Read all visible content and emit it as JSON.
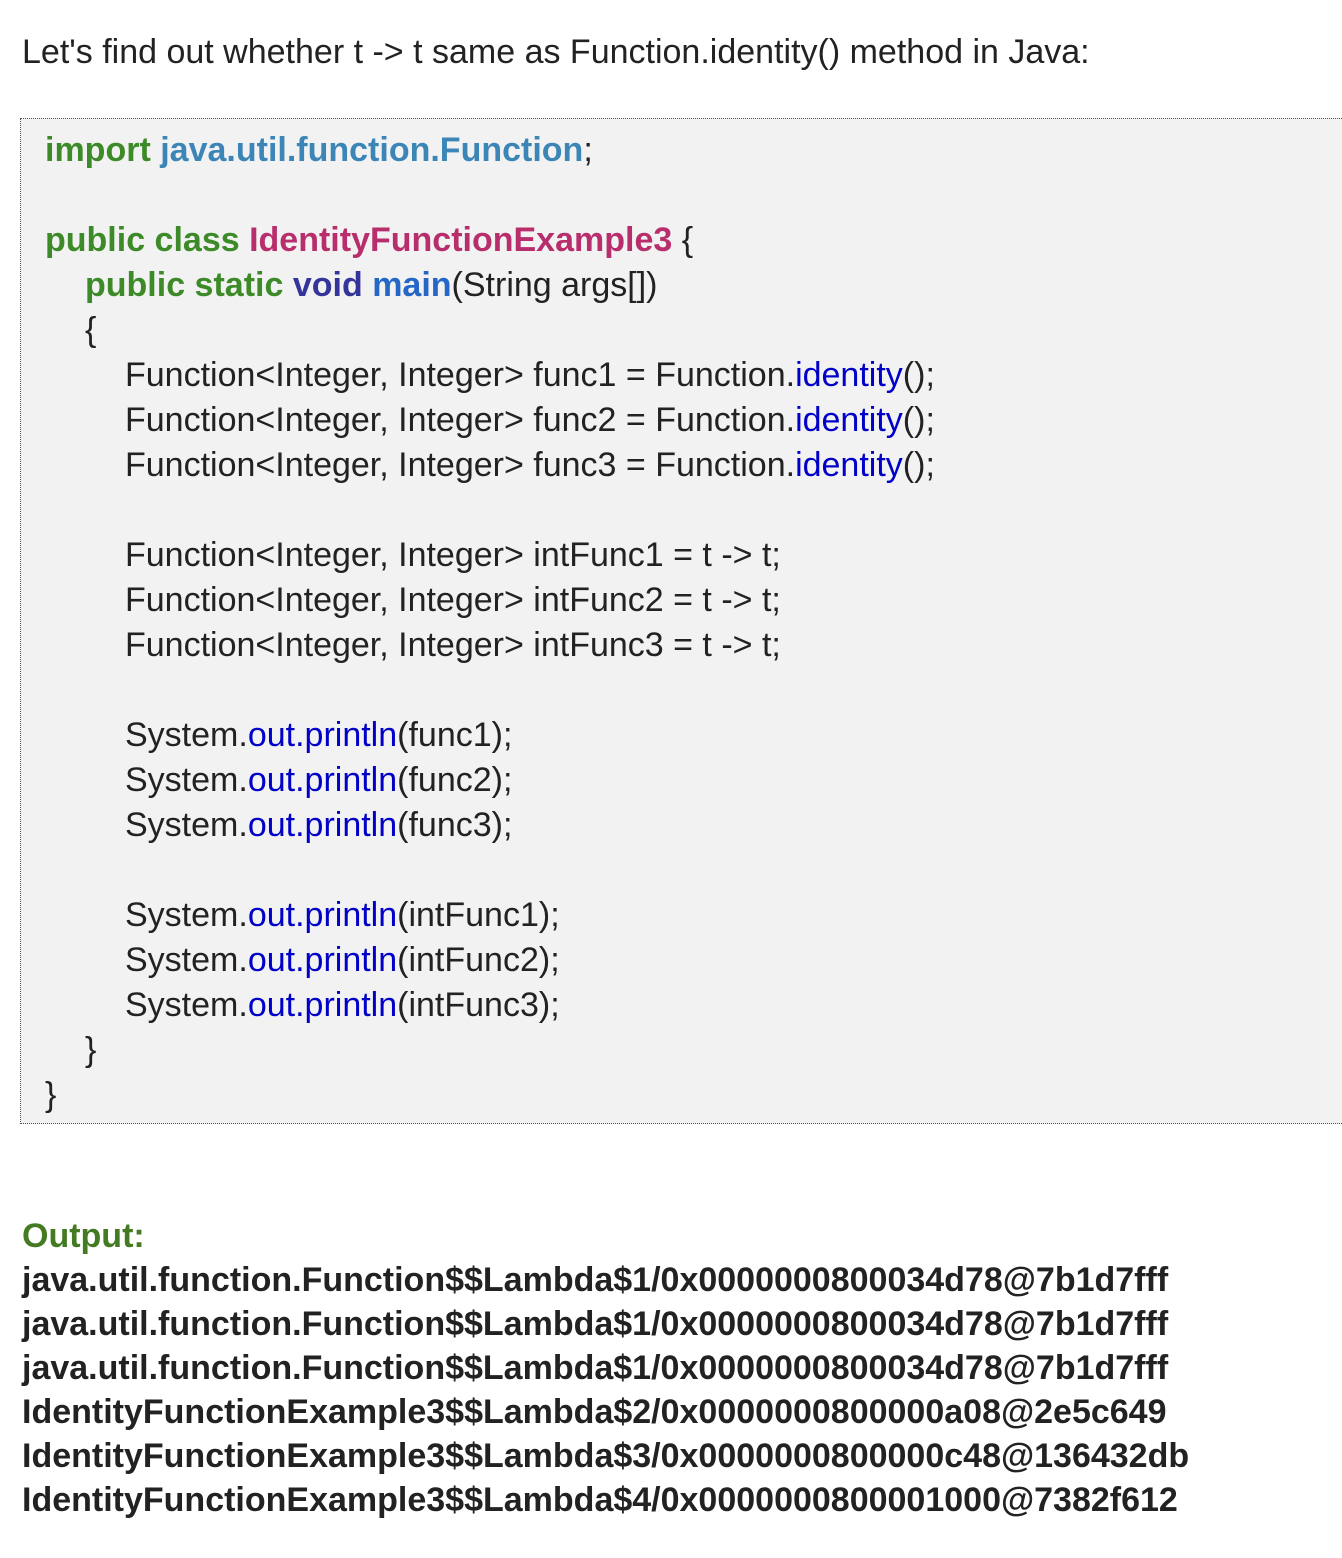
{
  "intro": "Let's find out whether t -> t same as Function.identity() method in Java:",
  "code": {
    "import_keyword": "import",
    "import_package": "java.util.function.Function",
    "import_semicolon": ";",
    "class_modifiers": "public class",
    "class_name": "IdentityFunctionExample3",
    "class_open_brace": " {",
    "main_modifiers": "public static",
    "main_return": "void",
    "main_name": "main",
    "main_params": "(String args[])",
    "open_brace": "{",
    "identity_decls": [
      {
        "prefix": "Function<Integer, Integer> func1 = Function.",
        "method": "identity",
        "suffix": "();"
      },
      {
        "prefix": "Function<Integer, Integer> func2 = Function.",
        "method": "identity",
        "suffix": "();"
      },
      {
        "prefix": "Function<Integer, Integer> func3 = Function.",
        "method": "identity",
        "suffix": "();"
      }
    ],
    "lambda_decls": [
      "Function<Integer, Integer> intFunc1 = t -> t;",
      "Function<Integer, Integer> intFunc2 = t -> t;",
      "Function<Integer, Integer> intFunc3 = t -> t;"
    ],
    "print_prefix": "System.",
    "print_out": "out",
    "print_dot": ".",
    "print_method": "println",
    "print_args_1": [
      "(func1);",
      "(func2);",
      "(func3);"
    ],
    "print_args_2": [
      "(intFunc1);",
      "(intFunc2);",
      "(intFunc3);"
    ],
    "close_method_brace": "}",
    "close_class_brace": "}"
  },
  "output": {
    "label": "Output:",
    "lines": [
      "java.util.function.Function$$Lambda$1/0x0000000800034d78@7b1d7fff",
      "java.util.function.Function$$Lambda$1/0x0000000800034d78@7b1d7fff",
      "java.util.function.Function$$Lambda$1/0x0000000800034d78@7b1d7fff",
      "IdentityFunctionExample3$$Lambda$2/0x0000000800000a08@2e5c649",
      "IdentityFunctionExample3$$Lambda$3/0x0000000800000c48@136432db",
      "IdentityFunctionExample3$$Lambda$4/0x0000000800001000@7382f612"
    ]
  }
}
